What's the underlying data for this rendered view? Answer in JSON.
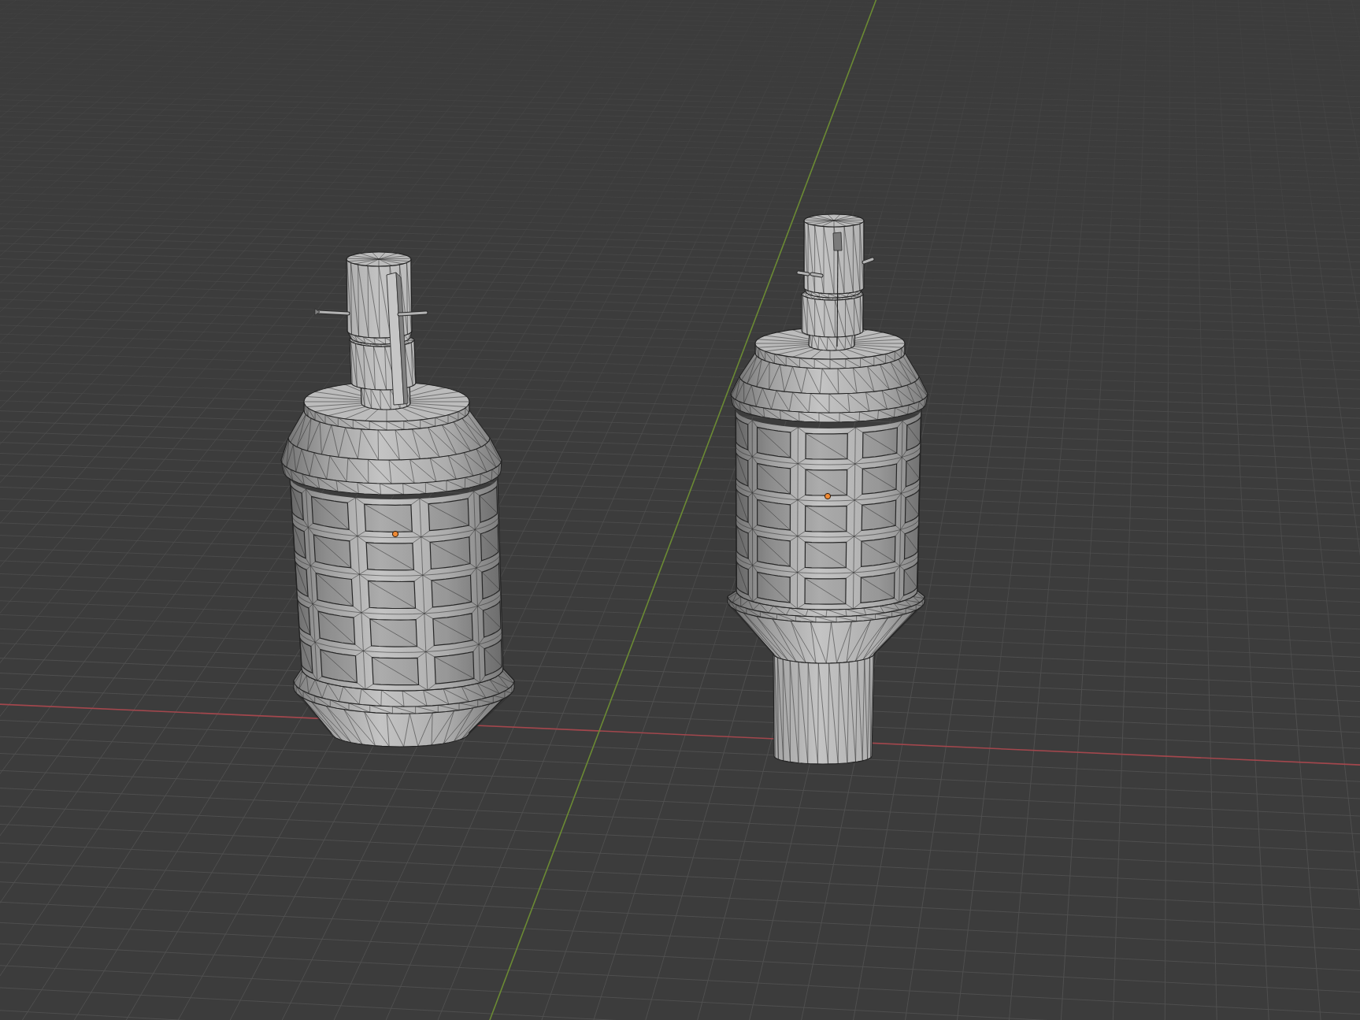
{
  "viewport": {
    "axes": [
      {
        "kind": "x",
        "color": "#a3474d"
      },
      {
        "kind": "y",
        "color": "#6b8a34"
      }
    ],
    "objects": [
      {
        "kind": "plain"
      },
      {
        "kind": "tailed"
      }
    ]
  }
}
